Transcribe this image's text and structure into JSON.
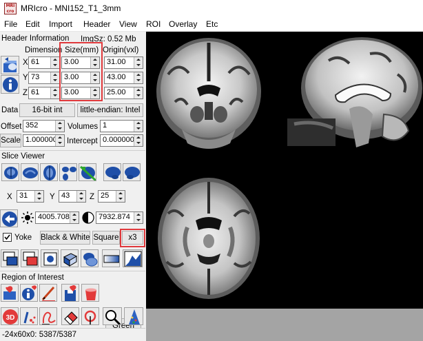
{
  "window": {
    "title": "MRIcro - MNI152_T1_3mm",
    "icon_text": "MRI cro"
  },
  "menu": [
    "File",
    "Edit",
    "Import",
    "Header",
    "View",
    "ROI",
    "Overlay",
    "Etc"
  ],
  "header": {
    "title": "Header Information",
    "img_size": "ImgSz: 0.52 Mb",
    "col_dimension": "Dimension",
    "col_size": "Size(mm)",
    "col_origin": "Origin(vxl)",
    "rows": [
      {
        "axis": "X",
        "dimension": "61",
        "size": "3.00",
        "origin": "31.00"
      },
      {
        "axis": "Y",
        "dimension": "73",
        "size": "3.00",
        "origin": "43.00"
      },
      {
        "axis": "Z",
        "dimension": "61",
        "size": "3.00",
        "origin": "25.00"
      }
    ],
    "data_label": "Data",
    "data_type": "16-bit int",
    "endian": "little-endian: Intel",
    "offset_label": "Offset",
    "offset_value": "352",
    "volumes_label": "Volumes",
    "volumes_value": "1",
    "scale_label": "Scale",
    "scale_value": "1.000000",
    "intercept_label": "Intercept",
    "intercept_value": "0.000000"
  },
  "slice_viewer": {
    "title": "Slice Viewer",
    "x_label": "X",
    "x_value": "31",
    "y_label": "Y",
    "y_value": "43",
    "z_label": "Z",
    "z_value": "25",
    "brightness": "4005.708",
    "contrast": "7932.874",
    "yoke_label": "Yoke",
    "yoke_checked": true,
    "color_scheme": "Black & White",
    "shape": "Square",
    "zoom": "x3"
  },
  "roi": {
    "title": "Region of Interest",
    "color_button": "Green",
    "tool_3d_text": "3D"
  },
  "status": "-24x60x0: 5387/5387",
  "colors": {
    "highlight": "#e0393c",
    "accent_blue": "#1f4fa8",
    "viewer_bg": "#000000",
    "viewer_bottom": "#a4a4a4"
  },
  "icons": [
    "open-icon",
    "info-icon",
    "slice-view-icons",
    "brightness-icon",
    "contrast-icon",
    "roi-tools-icons",
    "magnify-icon",
    "cone-icon"
  ]
}
